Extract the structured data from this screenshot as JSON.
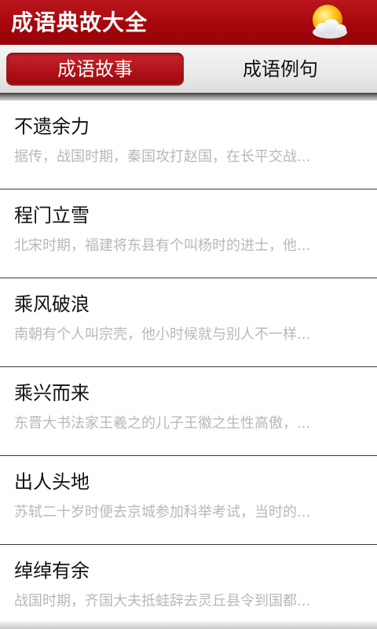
{
  "header": {
    "title": "成语典故大全",
    "icon": "weather-sun-cloud-icon"
  },
  "tabs": [
    {
      "label": "成语故事",
      "active": true
    },
    {
      "label": "成语例句",
      "active": false
    }
  ],
  "list": [
    {
      "title": "不遗余力",
      "summary": "据传，战国时期，秦国攻打赵国，在长平交战..."
    },
    {
      "title": "程门立雪",
      "summary": "北宋时期，福建将东县有个叫杨时的进士，他..."
    },
    {
      "title": "乘风破浪",
      "summary": "南朝有个人叫宗壳，他小时候就与别人不一样..."
    },
    {
      "title": "乘兴而来",
      "summary": "东晋大书法家王羲之的儿子王徽之生性高傲，..."
    },
    {
      "title": "出人头地",
      "summary": "苏轼二十岁时便去京城参加科举考试，当时的..."
    },
    {
      "title": "绰绰有余",
      "summary": "战国时期，齐国大夫抵蛙辞去灵丘县令到国都..."
    }
  ],
  "colors": {
    "titlebar": "#a5060c",
    "active_tab": "#b1131a",
    "summary_text": "#b8b8b8"
  }
}
